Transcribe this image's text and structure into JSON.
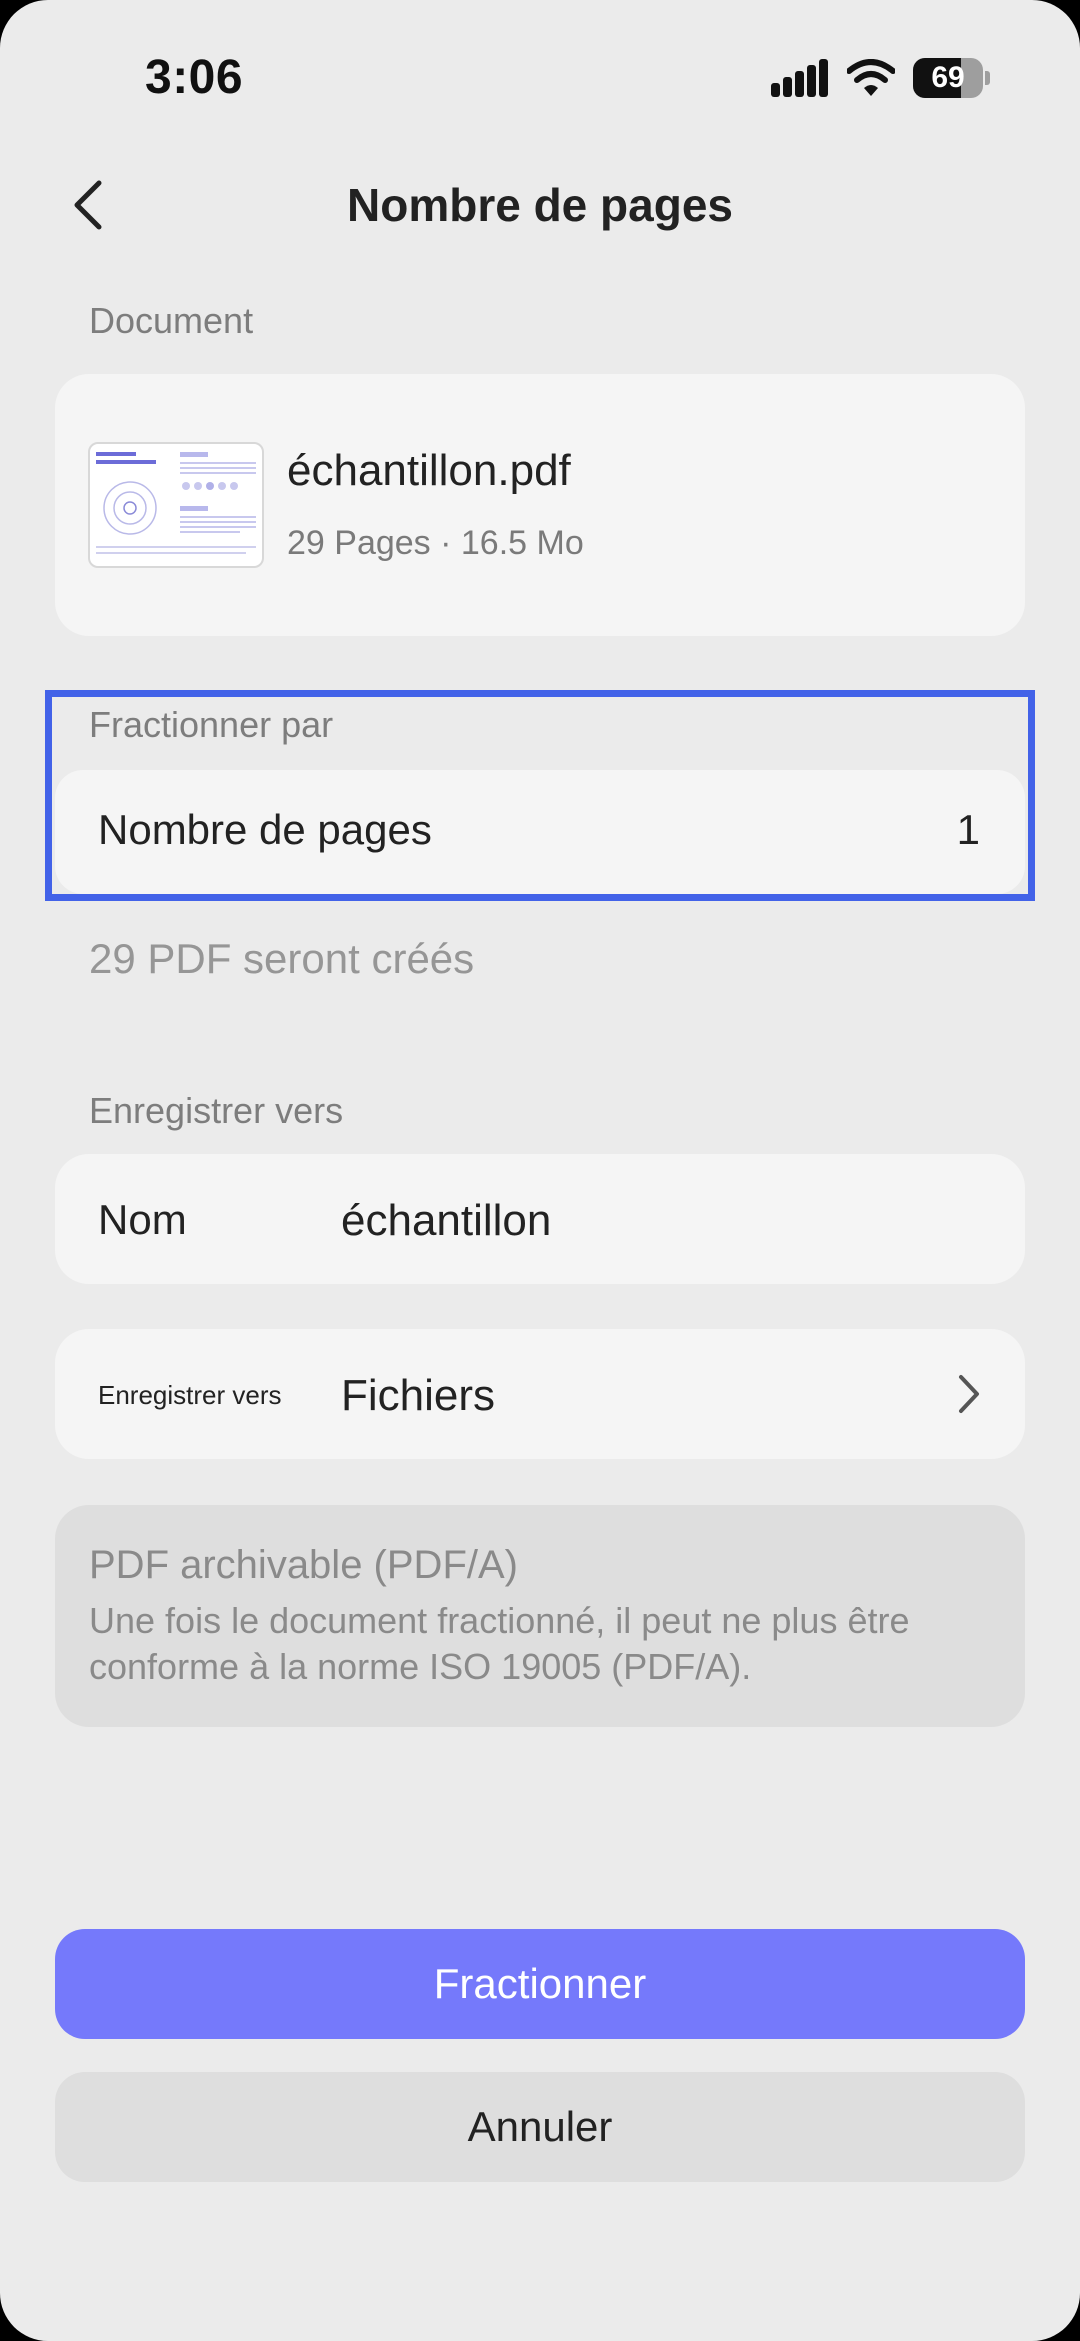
{
  "status_bar": {
    "time": "3:06",
    "battery": "69",
    "battery_level": 0.69
  },
  "nav": {
    "back_icon": "chevron-left-icon",
    "title": "Nombre de pages"
  },
  "document_section": {
    "label": "Document",
    "file_name": "échantillon.pdf",
    "file_meta": "29 Pages · 16.5 Mo"
  },
  "split_section": {
    "label": "Fractionner par",
    "row_label": "Nombre de pages",
    "row_value": "1",
    "highlight_color": "#4262e8"
  },
  "result_note": "29 PDF seront créés",
  "save_section": {
    "label": "Enregistrer vers",
    "name_key": "Nom",
    "name_value": "échantillon",
    "location_key": "Enregistrer vers",
    "location_value": "Fichiers",
    "location_icon": "chevron-right-icon"
  },
  "pdfa": {
    "title": "PDF archivable (PDF/A)",
    "description": "Une fois le document fractionné, il peut ne plus être conforme à la norme ISO 19005 (PDF/A)."
  },
  "buttons": {
    "primary": "Fractionner",
    "secondary": "Annuler"
  },
  "colors": {
    "background": "#ebebeb",
    "card": "#f5f5f5",
    "primary_button": "#7579fb",
    "highlight": "#4262e8"
  }
}
